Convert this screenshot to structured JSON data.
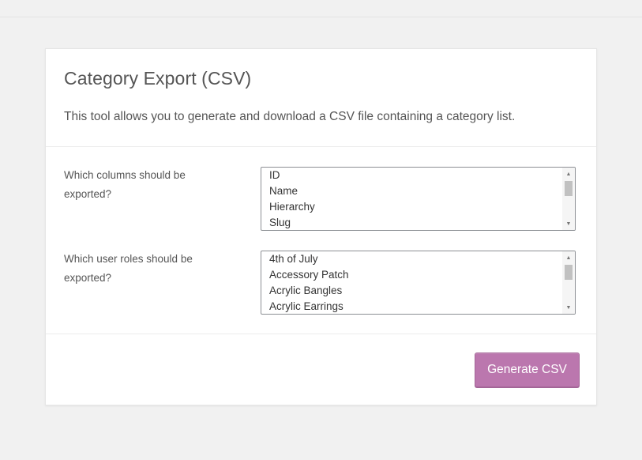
{
  "export_panel": {
    "title": "Category Export (CSV)",
    "description": "This tool allows you to generate and download a CSV file containing a category list.",
    "columns_field": {
      "label": "Which columns should be exported?",
      "options": [
        "ID",
        "Name",
        "Hierarchy",
        "Slug"
      ]
    },
    "roles_field": {
      "label": "Which user roles should be exported?",
      "options": [
        "4th of July",
        "Accessory Patch",
        "Acrylic Bangles",
        "Acrylic Earrings"
      ]
    },
    "generate_button_label": "Generate CSV"
  },
  "icons": {
    "scroll_up": "triangle-up-icon",
    "scroll_down": "triangle-down-icon"
  },
  "colors": {
    "background": "#f1f1f1",
    "card": "#ffffff",
    "button": "#bb77ae",
    "button_border": "#a36597",
    "text": "#555555"
  }
}
